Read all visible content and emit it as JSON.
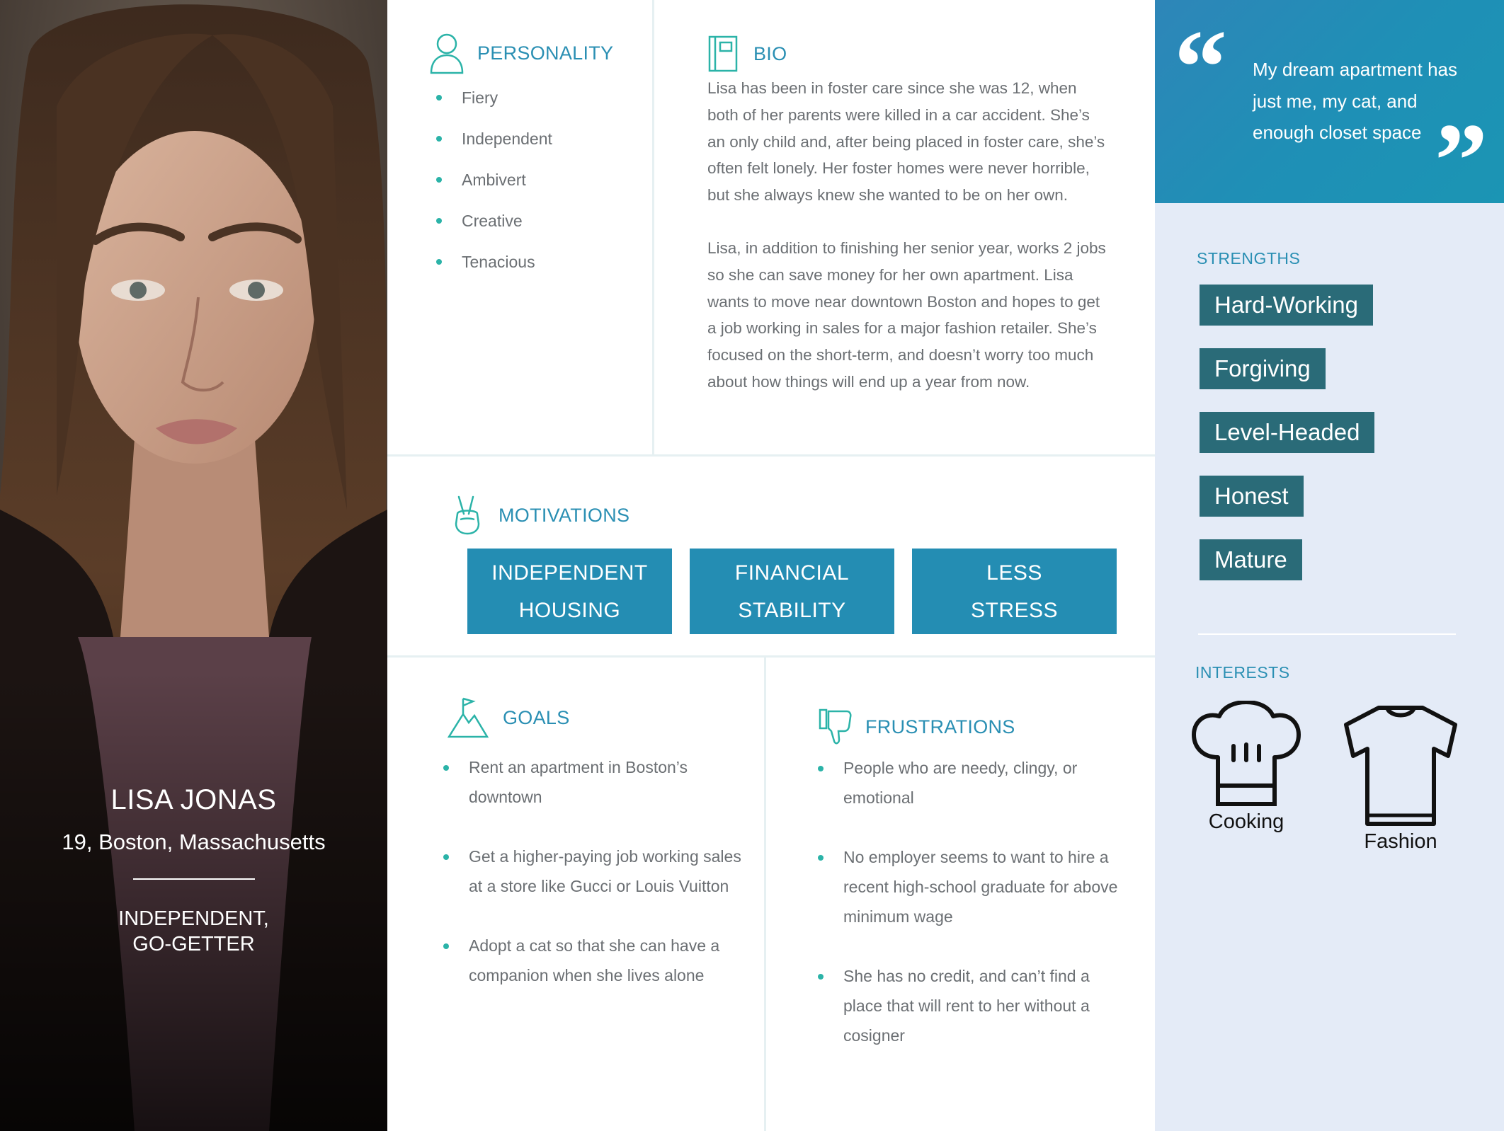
{
  "persona": {
    "name": "LISA JONAS",
    "location": "19, Boston, Massachusetts",
    "tagline_line1": "INDEPENDENT,",
    "tagline_line2": "GO-GETTER"
  },
  "personality": {
    "title": "PERSONALITY",
    "icon": "person-icon",
    "items": [
      "Fiery",
      "Independent",
      "Ambivert",
      "Creative",
      "Tenacious"
    ]
  },
  "bio": {
    "title": "BIO",
    "icon": "notebook-icon",
    "paragraphs": [
      "Lisa has been in foster care since she was 12, when both of her parents were killed in a car accident. She’s an only child and, after being placed in foster care, she’s  often felt lonely. Her foster homes were never horrible, but she always knew she wanted to be on her own.",
      "Lisa, in addition to finishing her senior year, works 2 jobs so she can save money for her own apartment. Lisa wants to move near downtown Boston and hopes to get a job working in sales for a major fashion retailer. She’s focused on the short-term, and doesn’t worry too much about how things will end up a year from now."
    ]
  },
  "motivations": {
    "title": "MOTIVATIONS",
    "icon": "peace-hand-icon",
    "items": [
      {
        "line1": "INDEPENDENT",
        "line2": "HOUSING"
      },
      {
        "line1": "FINANCIAL",
        "line2": "STABILITY"
      },
      {
        "line1": "LESS",
        "line2": "STRESS"
      }
    ]
  },
  "goals": {
    "title": "GOALS",
    "icon": "mountain-flag-icon",
    "items": [
      "Rent an apartment in Boston’s downtown",
      "Get a higher-paying job working sales at a store like Gucci or Louis Vuitton",
      "Adopt a cat so that she can have a companion when she lives alone"
    ]
  },
  "frustrations": {
    "title": "FRUSTRATIONS",
    "icon": "thumbs-down-icon",
    "items": [
      "People who are needy, clingy, or emotional",
      "No employer seems to want to hire a recent high-school graduate for above minimum wage",
      "She has no credit, and can’t find a place that will rent to her without a cosigner"
    ]
  },
  "quote": {
    "text": "My dream apartment has just me, my cat, and enough closet space"
  },
  "strengths": {
    "title": "STRENGTHS",
    "items": [
      "Hard-Working",
      "Forgiving",
      "Level-Headed",
      "Honest",
      "Mature"
    ]
  },
  "interests": {
    "title": "INTERESTS",
    "items": [
      {
        "label": "Cooking",
        "icon": "chef-hat-icon"
      },
      {
        "label": "Fashion",
        "icon": "tshirt-icon"
      }
    ]
  },
  "colors": {
    "accent": "#2a8fb3",
    "motivation_box": "#248db3",
    "strength_tag": "#2a6b78",
    "right_panel": "#e4ebf7",
    "bullet": "#2bb3a8"
  }
}
